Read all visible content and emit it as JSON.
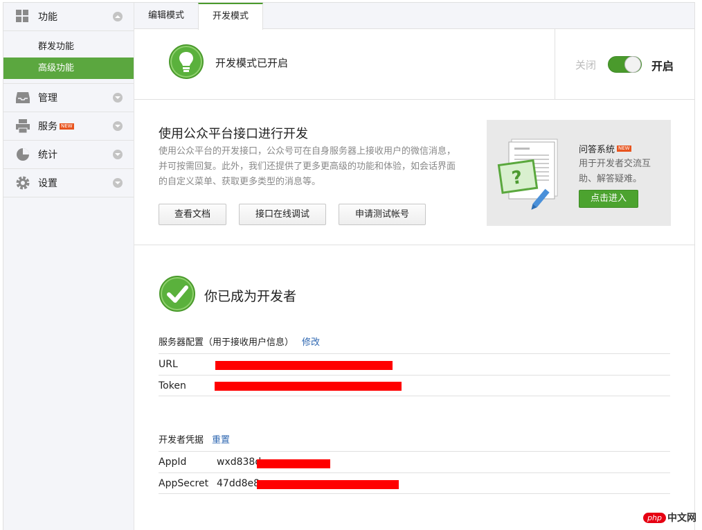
{
  "sidebar": {
    "groups": [
      {
        "label": "功能",
        "icon": "grid-icon",
        "expanded": true,
        "sub": [
          "群发功能",
          "高级功能"
        ],
        "active_sub": 1
      },
      {
        "label": "管理",
        "icon": "inbox-icon"
      },
      {
        "label": "服务",
        "icon": "printer-icon",
        "badge": "NEW"
      },
      {
        "label": "统计",
        "icon": "pie-chart-icon"
      },
      {
        "label": "设置",
        "icon": "gear-icon"
      }
    ]
  },
  "tabs": {
    "edit": "编辑模式",
    "dev": "开发模式",
    "active": "dev"
  },
  "mode": {
    "status": "开发模式已开启",
    "off_label": "关闭",
    "on_label": "开启",
    "enabled": true
  },
  "intro": {
    "title": "使用公众平台接口进行开发",
    "description": "使用公众平台的开发接口，公众号可在自身服务器上接收用户的微信消息，并可按需回复。此外，我们还提供了更多更高级的功能和体验，如会话界面的自定义菜单、获取更多类型的消息等。",
    "buttons": [
      "查看文档",
      "接口在线调试",
      "申请测试帐号"
    ]
  },
  "promo": {
    "title": "问答系统",
    "badge": "NEW",
    "description": "用于开发者交流互助、解答疑难。",
    "button": "点击进入"
  },
  "developer": {
    "title": "你已成为开发者",
    "server_config": {
      "heading": "服务器配置（用于接收用户信息）",
      "link": "修改",
      "rows": [
        {
          "key": "URL",
          "value": ""
        },
        {
          "key": "Token",
          "value": ""
        }
      ]
    },
    "credentials": {
      "heading": "开发者凭据",
      "link": "重置",
      "rows": [
        {
          "key": "AppId",
          "value": "wxd838d"
        },
        {
          "key": "AppSecret",
          "value": "47dd8e8"
        }
      ]
    }
  },
  "watermark": {
    "brand": "php",
    "text": "中文网"
  },
  "colors": {
    "accent_green": "#5ba73f",
    "link_blue": "#2e67b1",
    "redaction": "#ff0000"
  }
}
